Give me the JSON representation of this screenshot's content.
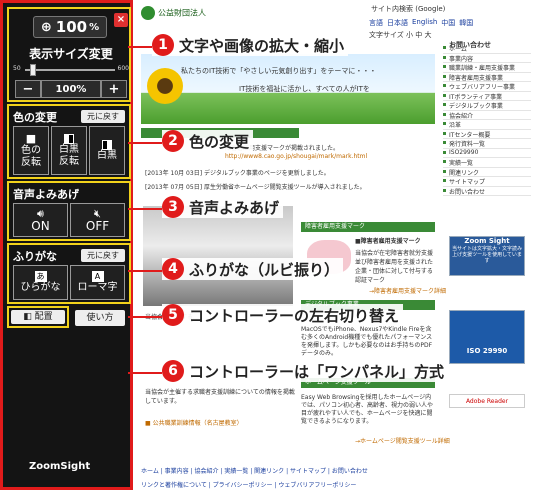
{
  "controller": {
    "zoom_value": "100",
    "zoom_unit": "%",
    "close_symbol": "×",
    "zoom_title": "表示サイズ変更",
    "slider_min": "50",
    "slider_max": "600",
    "slider_level_fraction": 0.09,
    "minus_label": "−",
    "zoom_reset_label": "100%",
    "plus_label": "+",
    "color_title": "色の変更",
    "color_reset_label": "元に戻す",
    "color_buttons": [
      "色の",
      "反転",
      "白黒",
      "反転",
      "白黒"
    ],
    "voice_title": "音声よみあげ",
    "voice_on": "ON",
    "voice_off": "OFF",
    "furigana_title": "ふりがな",
    "furigana_reset_label": "元に戻す",
    "hiragana_icon": "あ",
    "hiragana_label": "ひらがな",
    "romaji_icon": "A",
    "romaji_label": "ローマ字",
    "placement_label": "配置",
    "howto_label": "使い方",
    "brand": "ZoomSight",
    "accent_color": "#e01b1b",
    "highlight_color": "#f2d21b"
  },
  "site": {
    "org_small": "公益財団法人",
    "site_search": "サイト内検索 (Google)",
    "lang_items": [
      "言語",
      "日本語",
      "English",
      "中国",
      "韓国"
    ],
    "text_size": "文字サイズ 小 中 大",
    "side_heading": "お問い合わせ",
    "hero_line1": "私たちのIT技術で「やさしい元気創り出す」をテーマに・・・",
    "hero_line2": "IT技術を福祉に活かし、すべての人がITを",
    "news_lines": [
      "障害者雇用支援マークが掲載されました。",
      "http://www8.cao.go.jp/shougai/mark/mark.html",
      "[2013年 10月 03日] デジタルブック事業のページを更新しました。",
      "[2013年 07月 05日] 厚生労働省ホームページ閲覧支援ツールが導入されました。"
    ],
    "mark_title": "障害者雇用支援マーク",
    "mark_heading": "■障害者雇用支援マーク",
    "mark_text": "当協会が在宅障害者就労支援並び障害者雇用を支援された企業・団体に対して付与する認証マーク",
    "mark_link": "→障害者雇用支援マーク詳細",
    "digital_book_title": "デジタルブック事業",
    "digital_book_text": "MacOSでもiPhone、Nexus7やKindle Fireを含む多くのAndroid機種でも優れたパフォーマンスを発揮します。しかも必要なのはお手持ちのPDFデータのみ。",
    "hp_tool_title": "ホームページ支援ツール",
    "hp_tool_text": "Easy Web Browsingを採用したホームページ内では、パソコン初心者、高齢者、視力の弱い人や目が疲れやすい人でも、ホームページを快適に閲覧できるようになります。",
    "hp_tool_link": "→ホームページ閲覧支援ツール詳細",
    "left_lines": [
      "当協会が主催する…",
      "当協会が主催する求職者支援訓練についての情報を掲載しています。",
      "■ 公共職業訓練情報（名古屋教室）"
    ],
    "side_menu": [
      "ホーム",
      "事業内容",
      "職業訓練・雇用支援事業",
      "障害者雇用支援事業",
      "ウェブバリアフリー事業",
      "ITボランティア事業",
      "デジタルブック事業",
      "協会紹介",
      "沿革",
      "ITセンター概要",
      "発行資料一覧",
      "ISO29990",
      "実績一覧",
      "関連リンク",
      "サイトマップ",
      "お問い合わせ"
    ],
    "badge_zoom": "Zoom Sight",
    "badge_zoom_sub": "当サイトは文字拡大・文字読み上げ支援ツールを使用しています",
    "badge_iso": "ISO 29990",
    "badge_pdf": "Adobe Reader",
    "footer_links": "ホーム | 事業内容 | 協会紹介 | 実績一覧 | 関連リンク | サイトマップ | お問い合わせ",
    "footer_links2": "リンクと著作権について | プライバシーポリシー | ウェブバリアフリーポリシー"
  },
  "annotations": [
    {
      "num": "1",
      "text": "文字や画像の拡大・縮小"
    },
    {
      "num": "2",
      "text": "色の変更"
    },
    {
      "num": "3",
      "text": "音声よみあげ"
    },
    {
      "num": "4",
      "text": "ふりがな（ルビ振り）"
    },
    {
      "num": "5",
      "text": "コントローラーの左右切り替え"
    },
    {
      "num": "6",
      "text": "コントローラーは「ワンパネル」方式"
    }
  ]
}
